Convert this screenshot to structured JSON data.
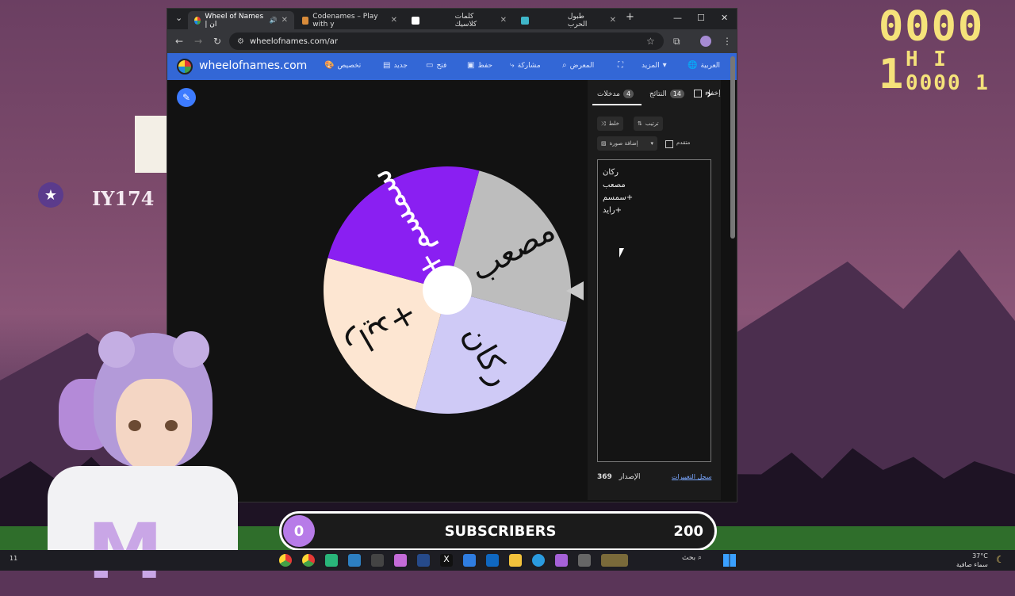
{
  "scene": {
    "score": "0000 1",
    "hi_score": "H I 0000 1",
    "player_tag": "IY174"
  },
  "browser": {
    "tabs": [
      {
        "label": "Wheel of Names | ان",
        "active": true
      },
      {
        "label": "Codenames – Play with y",
        "active": false
      },
      {
        "label": "كلمات كلاسيك",
        "active": false
      },
      {
        "label": "طبول الحرب",
        "active": false
      }
    ],
    "new_tab": "+",
    "url": "wheelofnames.com/ar"
  },
  "app": {
    "site_name": "wheelofnames.com",
    "menu": [
      {
        "label": "تخصيص",
        "icon": "palette-icon"
      },
      {
        "label": "جديد",
        "icon": "file-icon"
      },
      {
        "label": "فتح",
        "icon": "folder-icon"
      },
      {
        "label": "حفظ",
        "icon": "save-icon"
      },
      {
        "label": "مشاركة",
        "icon": "share-icon"
      },
      {
        "label": "المعرض",
        "icon": "search-icon"
      },
      {
        "label": "",
        "icon": "fullscreen-icon"
      },
      {
        "label": "المزيد",
        "icon": "chevron-down-icon"
      },
      {
        "label": "العربية",
        "icon": "globe-icon"
      }
    ]
  },
  "wheel": {
    "segments": [
      {
        "label": "مصعب",
        "color": "#bdbdbd",
        "text_color": "#111111"
      },
      {
        "label": "ركان",
        "color": "#cfcaf6",
        "text_color": "#111111"
      },
      {
        "label": "+رايد",
        "color": "#fde6d2",
        "text_color": "#111111"
      },
      {
        "label": "+سمسم",
        "color": "#8a1ff2",
        "text_color": "#ffffff"
      }
    ]
  },
  "panel": {
    "tab_entries": "مدخلات",
    "entries_count": "4",
    "tab_results": "النتائج",
    "results_count": "14",
    "tab_hide": "إخفاء",
    "shuffle_label": "خلط",
    "sort_label": "ترتيب",
    "add_image_label": "إضافة صورة",
    "advanced_label": "متقدم",
    "entries": [
      "ركان",
      "مصعب",
      "+سمسم",
      "+رايد"
    ],
    "version_label": "الإصدار",
    "version": "369",
    "changelog_label": "سجل التغييرات"
  },
  "subscribers": {
    "current": "0",
    "title": "SUBSCRIBERS",
    "goal": "200"
  },
  "taskbar": {
    "search_label": "بحث",
    "temperature": "37°C",
    "weather_text": "سماء صافية",
    "clock": "11"
  }
}
